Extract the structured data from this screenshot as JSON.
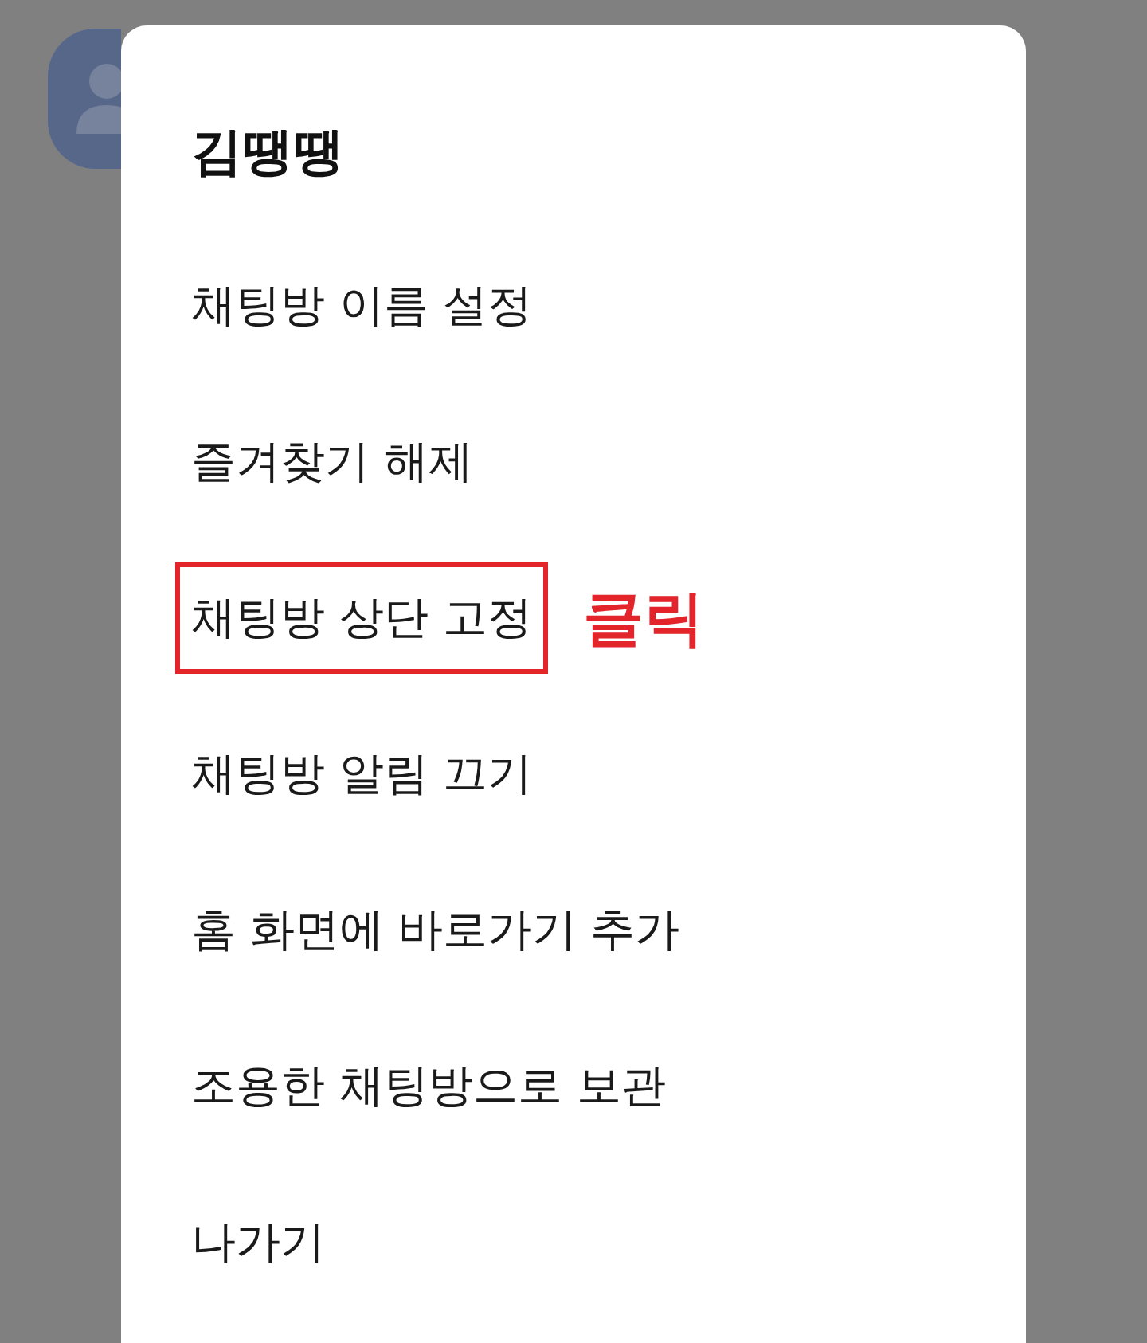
{
  "dialog": {
    "title": "김땡땡",
    "items": [
      {
        "label": "채팅방 이름 설정",
        "highlighted": false
      },
      {
        "label": "즐겨찾기 해제",
        "highlighted": false
      },
      {
        "label": "채팅방 상단 고정",
        "highlighted": true,
        "annotation": "클릭"
      },
      {
        "label": "채팅방 알림 끄기",
        "highlighted": false
      },
      {
        "label": "홈 화면에 바로가기 추가",
        "highlighted": false
      },
      {
        "label": "조용한 채팅방으로 보관",
        "highlighted": false
      },
      {
        "label": "나가기",
        "highlighted": false
      }
    ]
  }
}
